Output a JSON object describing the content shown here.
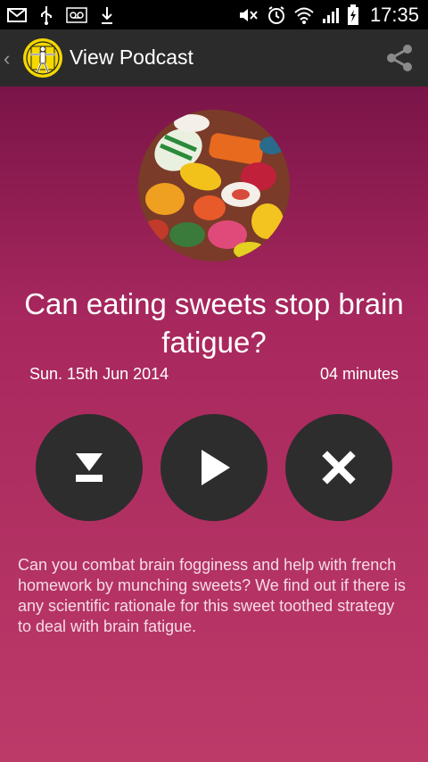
{
  "status_bar": {
    "time": "17:35",
    "left_icons": [
      "mail-icon",
      "usb-icon",
      "voicemail-icon",
      "download-icon"
    ],
    "right_icons": [
      "mute-icon",
      "alarm-icon",
      "wifi-icon",
      "signal-icon",
      "battery-charging-icon"
    ]
  },
  "action_bar": {
    "title": "View Podcast",
    "back_icon": "back-chevron-icon",
    "logo_icon": "vitruvian-man-logo",
    "share_icon": "share-icon"
  },
  "podcast": {
    "cover_description_icon": "sweets-cover-art",
    "title": "Can eating sweets stop brain fatigue?",
    "date": "Sun. 15th Jun 2014",
    "duration": "04 minutes",
    "description": "Can you combat brain fogginess and help with french homework by munching sweets? We find out if there is any scientific rationale for this sweet toothed strategy to deal with brain fatigue."
  },
  "controls": {
    "download_icon": "download-icon",
    "play_icon": "play-icon",
    "delete_icon": "close-icon"
  },
  "colors": {
    "background_top": "#7a1448",
    "background_bottom": "#bc3a68",
    "button_bg": "#2d2d2d",
    "action_bar_bg": "#2b2b2b"
  }
}
